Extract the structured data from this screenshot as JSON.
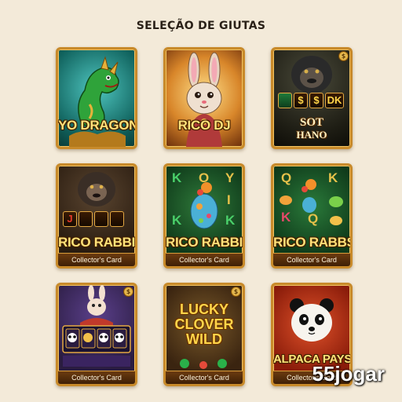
{
  "page": {
    "title": "SELEÇÃO DE GIUTAS"
  },
  "cards": [
    {
      "name": "YO DRAGON",
      "subtitle": ""
    },
    {
      "name": "RICO DJ",
      "subtitle": ""
    },
    {
      "name": "",
      "subtitle": "",
      "reel": [
        "",
        "$",
        "$",
        "DK"
      ],
      "logo_line1": "SOT",
      "logo_line2": "HANO"
    },
    {
      "name": "RICO RABBIT",
      "subtitle": "Collector's Card",
      "reel": [
        "J",
        "",
        "",
        ""
      ]
    },
    {
      "name": "RICO RABBIT",
      "subtitle": "Collector's Card",
      "symbols": [
        "K",
        "O",
        "Y",
        "I",
        "K",
        "K"
      ]
    },
    {
      "name": "RICO RABBS",
      "subtitle": "Collector's Card",
      "symbols": [
        "Q",
        "K",
        "K",
        "Q"
      ]
    },
    {
      "name": "",
      "subtitle": "Collector's Card"
    },
    {
      "name": "",
      "subtitle": "Collector's Card",
      "logo_line1": "LUCKY",
      "logo_line2": "CLOVER",
      "logo_line3": "WILD"
    },
    {
      "name": "ALPACA PAYS",
      "subtitle": "Collector's Card"
    }
  ],
  "watermark": "55jogar",
  "colors": {
    "background": "#f3ead9",
    "frame": "#c88a2a",
    "title_text": "#ffe27a"
  }
}
